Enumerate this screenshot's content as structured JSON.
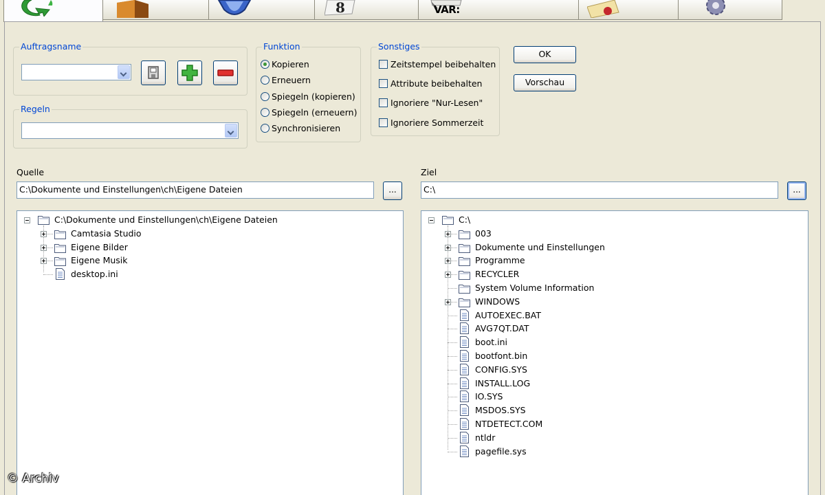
{
  "toolbar": {
    "tabs": [
      {
        "icon": "sync-icon",
        "active": true
      },
      {
        "icon": "box-icon"
      },
      {
        "icon": "shield-icon"
      },
      {
        "icon": "document-icon"
      },
      {
        "icon": "variables-icon",
        "label": "VAR:"
      },
      {
        "icon": "note-icon"
      },
      {
        "icon": "gear-icon"
      }
    ]
  },
  "auftragsname": {
    "legend": "Auftragsname",
    "value": ""
  },
  "regeln": {
    "legend": "Regeln",
    "value": ""
  },
  "funktion": {
    "legend": "Funktion",
    "options": [
      "Kopieren",
      "Erneuern",
      "Spiegeln (kopieren)",
      "Spiegeln (erneuern)",
      "Synchronisieren"
    ],
    "selected": "Kopieren"
  },
  "sonstiges": {
    "legend": "Sonstiges",
    "options": [
      {
        "label": "Zeitstempel beibehalten",
        "checked": false
      },
      {
        "label": "Attribute beibehalten",
        "checked": false
      },
      {
        "label": "Ignoriere \"Nur-Lesen\"",
        "checked": false
      },
      {
        "label": "Ignoriere Sommerzeit",
        "checked": false
      }
    ]
  },
  "buttons": {
    "ok": "OK",
    "preview": "Vorschau",
    "browse": "..."
  },
  "quelle": {
    "label": "Quelle",
    "path": "C:\\Dokumente und Einstellungen\\ch\\Eigene Dateien",
    "tree": {
      "root": "C:\\Dokumente und Einstellungen\\ch\\Eigene Dateien",
      "items": [
        {
          "name": "Camtasia Studio",
          "type": "folder",
          "expandable": true
        },
        {
          "name": "Eigene Bilder",
          "type": "folder",
          "expandable": true
        },
        {
          "name": "Eigene Musik",
          "type": "folder",
          "expandable": true
        },
        {
          "name": "desktop.ini",
          "type": "file",
          "expandable": false
        }
      ]
    }
  },
  "ziel": {
    "label": "Ziel",
    "path": "C:\\",
    "tree": {
      "root": "C:\\",
      "items": [
        {
          "name": "003",
          "type": "folder",
          "expandable": true
        },
        {
          "name": "Dokumente und Einstellungen",
          "type": "folder",
          "expandable": true
        },
        {
          "name": "Programme",
          "type": "folder",
          "expandable": true
        },
        {
          "name": "RECYCLER",
          "type": "folder",
          "expandable": true
        },
        {
          "name": "System Volume Information",
          "type": "folder",
          "expandable": false
        },
        {
          "name": "WINDOWS",
          "type": "folder",
          "expandable": true
        },
        {
          "name": "AUTOEXEC.BAT",
          "type": "file",
          "expandable": false
        },
        {
          "name": "AVG7QT.DAT",
          "type": "file",
          "expandable": false
        },
        {
          "name": "boot.ini",
          "type": "file",
          "expandable": false
        },
        {
          "name": "bootfont.bin",
          "type": "file",
          "expandable": false
        },
        {
          "name": "CONFIG.SYS",
          "type": "file",
          "expandable": false
        },
        {
          "name": "INSTALL.LOG",
          "type": "file",
          "expandable": false
        },
        {
          "name": "IO.SYS",
          "type": "file",
          "expandable": false
        },
        {
          "name": "MSDOS.SYS",
          "type": "file",
          "expandable": false
        },
        {
          "name": "NTDETECT.COM",
          "type": "file",
          "expandable": false
        },
        {
          "name": "ntldr",
          "type": "file",
          "expandable": false
        },
        {
          "name": "pagefile.sys",
          "type": "file",
          "expandable": false
        }
      ]
    }
  },
  "watermark": "© Archiv"
}
